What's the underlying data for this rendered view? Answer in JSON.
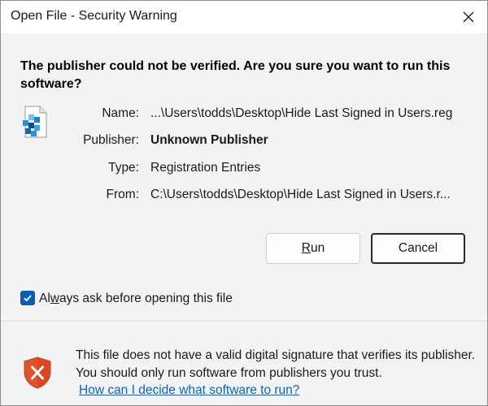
{
  "window": {
    "title": "Open File - Security Warning",
    "close_icon": "close-icon"
  },
  "question": "The publisher could not be verified.  Are you sure you want to run this software?",
  "file_icon": "registry-file-icon",
  "fields": {
    "name": {
      "label": "Name:",
      "value": "...\\Users\\todds\\Desktop\\Hide Last Signed in Users.reg"
    },
    "publisher": {
      "label": "Publisher:",
      "value": "Unknown Publisher"
    },
    "type": {
      "label": "Type:",
      "value": "Registration Entries"
    },
    "from": {
      "label": "From:",
      "value": "C:\\Users\\todds\\Desktop\\Hide Last Signed in Users.r..."
    }
  },
  "buttons": {
    "run": {
      "pre": "",
      "accel": "R",
      "post": "un"
    },
    "cancel": {
      "label": "Cancel"
    }
  },
  "always_ask": {
    "checked": true,
    "pre": "Al",
    "accel": "w",
    "post": "ays ask before opening this file"
  },
  "footer": {
    "shield_icon": "security-shield-warning-icon",
    "warning": "This file does not have a valid digital signature that verifies its publisher.  You should only run software from publishers you trust.",
    "help_link": "How can I decide what software to run?"
  },
  "colors": {
    "accent": "#0a5fb4",
    "link": "#0066cc",
    "shield": "#e0522b"
  }
}
